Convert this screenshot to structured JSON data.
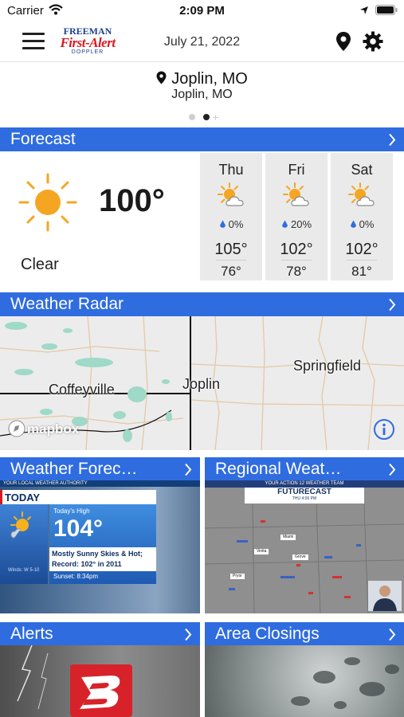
{
  "status_bar": {
    "carrier": "Carrier",
    "time": "2:09 PM"
  },
  "header": {
    "logo": {
      "brand": "FREEMAN",
      "main": "First-Alert",
      "sub": "DOPPLER"
    },
    "date": "July 21, 2022"
  },
  "location": {
    "city": "Joplin, MO",
    "subtitle": "Joplin, MO",
    "page_index": 1,
    "page_count": 3
  },
  "forecast": {
    "title": "Forecast",
    "current": {
      "temp": "100°",
      "condition": "Clear",
      "icon": "sun-icon"
    },
    "days": [
      {
        "day": "Thu",
        "precip": "0%",
        "high": "105°",
        "low": "76°",
        "icon": "partly-cloudy-icon"
      },
      {
        "day": "Fri",
        "precip": "20%",
        "high": "102°",
        "low": "78°",
        "icon": "partly-cloudy-icon"
      },
      {
        "day": "Sat",
        "precip": "0%",
        "high": "102°",
        "low": "81°",
        "icon": "partly-cloudy-icon"
      }
    ]
  },
  "radar": {
    "title": "Weather Radar",
    "labels": {
      "west": "Coffeyville",
      "center": "Joplin",
      "east": "Springfield"
    },
    "attribution": "mapbox"
  },
  "tiles": {
    "weather_forecast": {
      "title": "Weather Forec…",
      "video": {
        "strip": "YOUR LOCAL WEATHER AUTHORITY",
        "today": "TODAY",
        "high_label": "Today's High",
        "high_value": "104°",
        "description": "Mostly Sunny Skies & Hot; Record: 102° in 2011",
        "sunset": "Sunset: 8:34pm",
        "winds": "Winds: W 5-10"
      }
    },
    "regional_weather": {
      "title": "Regional Weat…",
      "video": {
        "strip": "YOUR ACTION 12 WEATHER TEAM",
        "headline": "FUTURECAST",
        "time": "THU 4:00 PM",
        "cities": [
          "Miami",
          "Vinita",
          "Grove",
          "Pryor"
        ]
      }
    },
    "alerts": {
      "title": "Alerts"
    },
    "area_closings": {
      "title": "Area Closings"
    }
  },
  "colors": {
    "accent": "#2f6ce0",
    "day_column": "#eaeaea",
    "map_background": "#ececec"
  }
}
